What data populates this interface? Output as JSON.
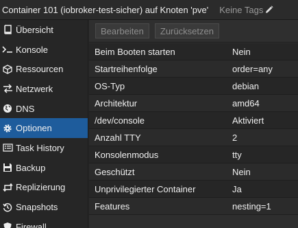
{
  "window": {
    "title": "Container 101 (iobroker-test-sicher) auf Knoten 'pve'",
    "tags_label": "Keine Tags"
  },
  "sidebar": {
    "items": [
      {
        "label": "Übersicht",
        "icon": "book-icon"
      },
      {
        "label": "Konsole",
        "icon": "terminal-icon"
      },
      {
        "label": "Ressourcen",
        "icon": "cube-icon"
      },
      {
        "label": "Netzwerk",
        "icon": "exchange-icon"
      },
      {
        "label": "DNS",
        "icon": "globe-icon"
      },
      {
        "label": "Optionen",
        "icon": "gear-icon",
        "active": true
      },
      {
        "label": "Task History",
        "icon": "list-icon"
      },
      {
        "label": "Backup",
        "icon": "floppy-icon"
      },
      {
        "label": "Replizierung",
        "icon": "retweet-icon"
      },
      {
        "label": "Snapshots",
        "icon": "history-icon"
      },
      {
        "label": "Firewall",
        "icon": "shield-icon"
      }
    ]
  },
  "toolbar": {
    "edit_label": "Bearbeiten",
    "reset_label": "Zurücksetzen"
  },
  "options": [
    {
      "key": "Beim Booten starten",
      "value": "Nein"
    },
    {
      "key": "Startreihenfolge",
      "value": "order=any"
    },
    {
      "key": "OS-Typ",
      "value": "debian"
    },
    {
      "key": "Architektur",
      "value": "amd64"
    },
    {
      "key": "/dev/console",
      "value": "Aktiviert"
    },
    {
      "key": "Anzahl TTY",
      "value": "2"
    },
    {
      "key": "Konsolenmodus",
      "value": "tty"
    },
    {
      "key": "Geschützt",
      "value": "Nein"
    },
    {
      "key": "Unprivilegierter Container",
      "value": "Ja"
    },
    {
      "key": "Features",
      "value": "nesting=1"
    }
  ],
  "colors": {
    "active_nav": "#1e5c9c",
    "background": "#262626"
  }
}
